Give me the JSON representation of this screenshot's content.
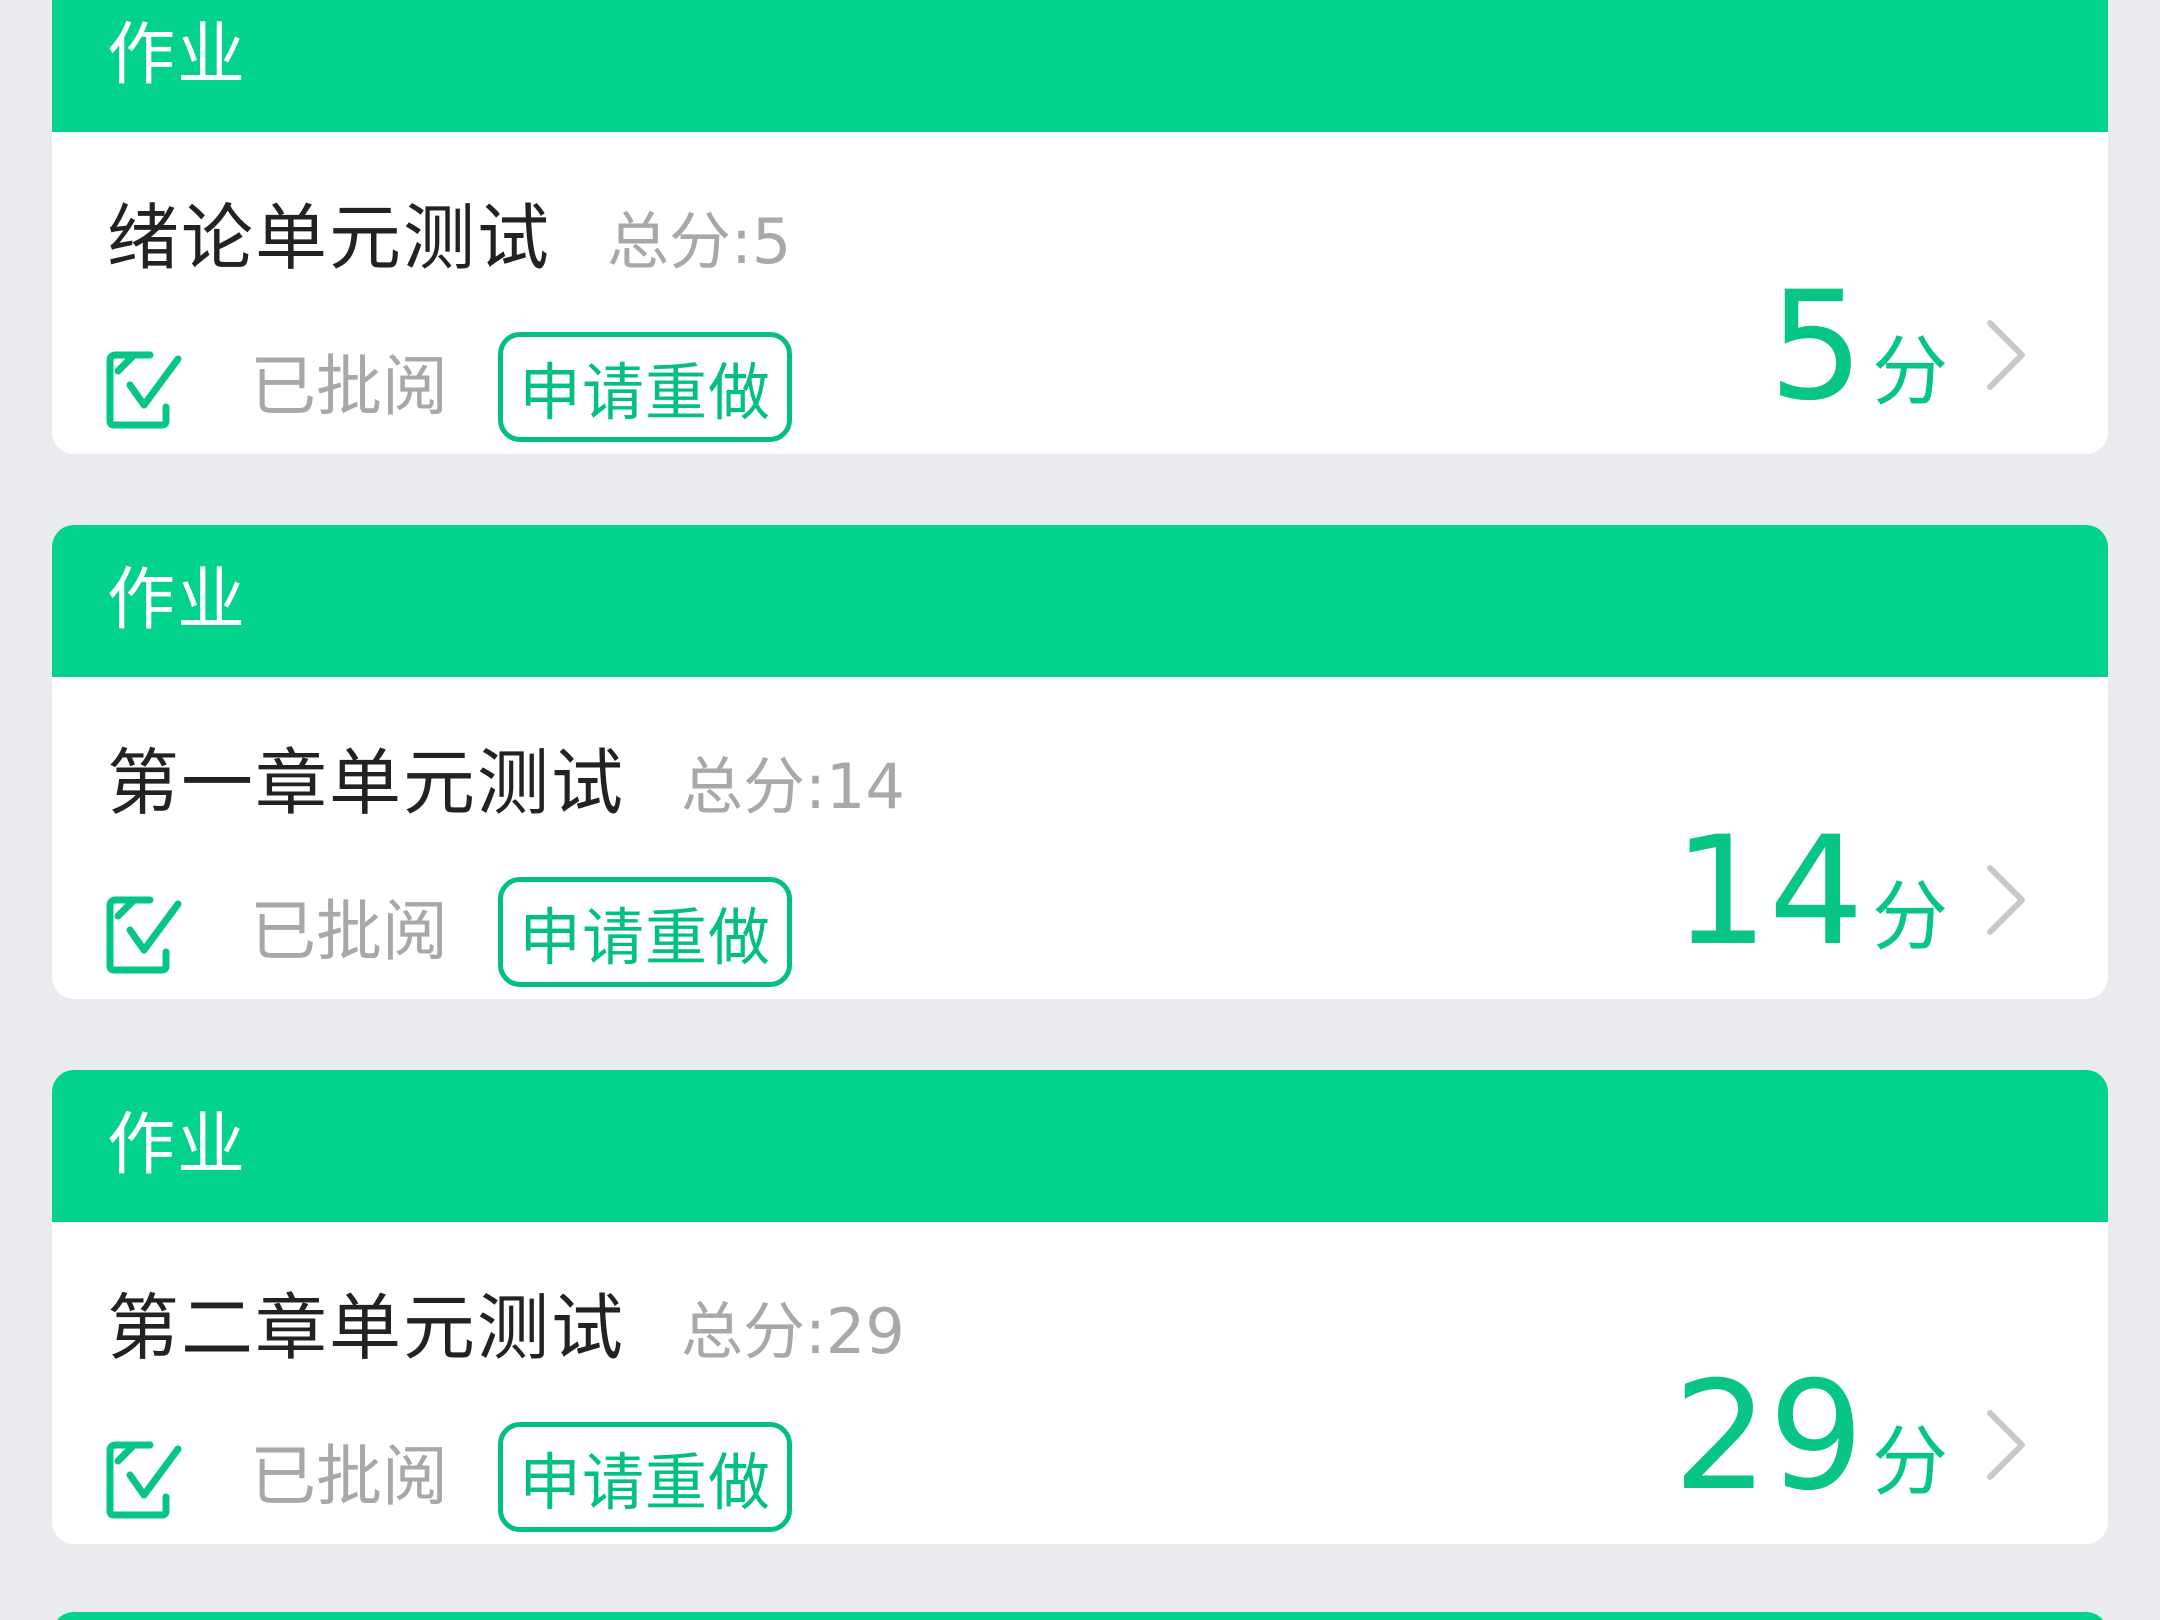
{
  "cards": [
    {
      "header": "作业",
      "title": "绪论单元测试",
      "total_label": "总分:5",
      "status": "已批阅",
      "redo_label": "申请重做",
      "score_value": "5",
      "score_unit": "分"
    },
    {
      "header": "作业",
      "title": "第一章单元测试",
      "total_label": "总分:14",
      "status": "已批阅",
      "redo_label": "申请重做",
      "score_value": "14",
      "score_unit": "分"
    },
    {
      "header": "作业",
      "title": "第二章单元测试",
      "total_label": "总分:29",
      "status": "已批阅",
      "redo_label": "申请重做",
      "score_value": "29",
      "score_unit": "分"
    }
  ],
  "colors": {
    "accent_green": "#03D38A",
    "score_green": "#06C585",
    "background": "#E9EBEE"
  },
  "icons": {
    "status": "reviewed-check-icon",
    "arrow": "chevron-right-icon"
  }
}
